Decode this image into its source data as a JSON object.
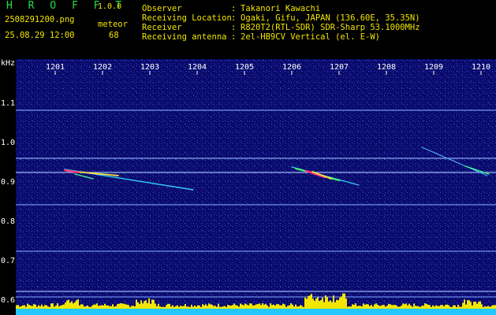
{
  "header": {
    "app_title": "H R O F F T",
    "app_version": "1.0.0",
    "file_name": "2508291200.png",
    "datetime": "25.08.29 12:00",
    "meteor_label": "meteor",
    "meteor_count": "68",
    "info": [
      {
        "label": "Observer",
        "value": "Takanori Kawachi"
      },
      {
        "label": "Receiving Location",
        "value": "Ogaki, Gifu, JAPAN (136.60E, 35.35N)"
      },
      {
        "label": "Receiver",
        "value": "R820T2(RTL-SDR) SDR-Sharp 53.1000MHz"
      },
      {
        "label": "Receiving antenna",
        "value": "2el-HB9CV Vertical (el. E-W)"
      }
    ]
  },
  "spectrogram": {
    "y_unit": "kHz",
    "x_ticks": [
      "1201",
      "1202",
      "1203",
      "1204",
      "1205",
      "1206",
      "1207",
      "1208",
      "1209",
      "1210"
    ],
    "y_ticks": [
      "1.1",
      "1.0",
      "0.9",
      "0.8",
      "0.7",
      "0.6"
    ],
    "colors": {
      "background": "#0a0a6a",
      "text": "#ffffff",
      "header_green": "#22e04a",
      "header_yellow": "#f2e600",
      "signal_bar": "#f2e600"
    }
  }
}
